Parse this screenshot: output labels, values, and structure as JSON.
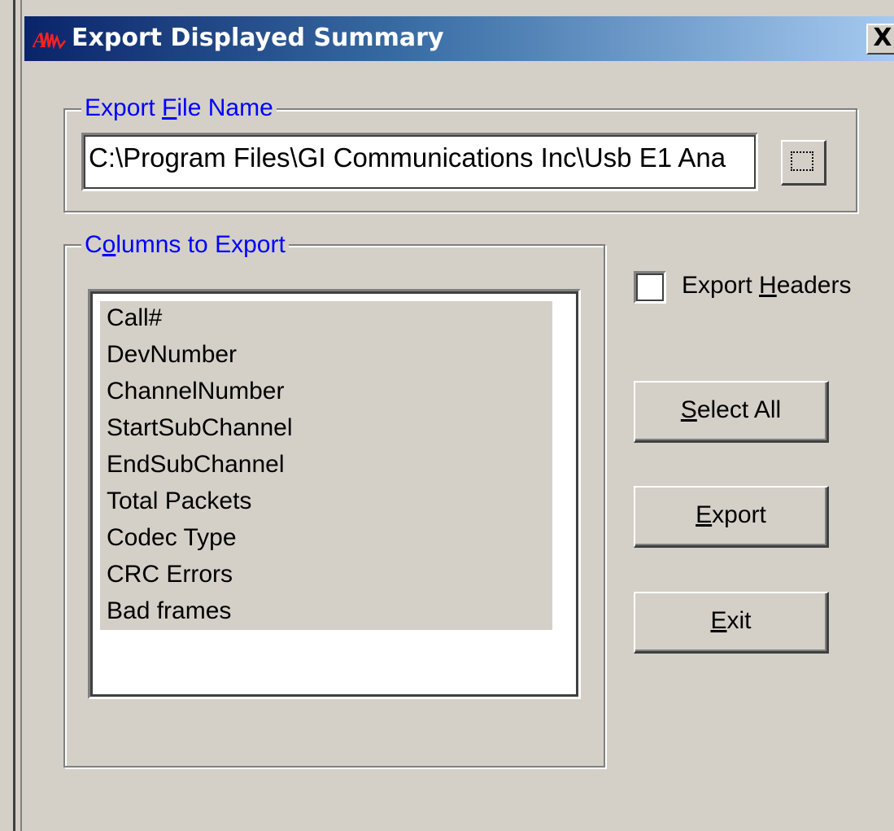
{
  "window": {
    "title": "Export Displayed Summary",
    "logo_icon": "app-logo-icon",
    "close_label": "X"
  },
  "export_file": {
    "legend_prefix": "Export ",
    "legend_accel": "F",
    "legend_suffix": "ile Name",
    "value": "C:\\Program Files\\GI Communications Inc\\Usb E1 Ana",
    "browse_icon": "browse-icon"
  },
  "columns": {
    "legend_prefix": "C",
    "legend_accel": "o",
    "legend_suffix": "lumns to Export",
    "items": [
      "Call#",
      "DevNumber",
      "ChannelNumber",
      "StartSubChannel",
      "EndSubChannel",
      "Total Packets",
      "Codec Type",
      "CRC Errors",
      "Bad frames"
    ]
  },
  "export_headers": {
    "prefix": "Export ",
    "accel": "H",
    "suffix": "eaders",
    "checked": false
  },
  "buttons": {
    "select_all": {
      "accel": "S",
      "rest": "elect All"
    },
    "export": {
      "accel": "E",
      "rest": "xport"
    },
    "exit": {
      "accel": "E",
      "rest": "xit"
    }
  },
  "colors": {
    "title_gradient_start": "#0a246a",
    "title_gradient_end": "#a6caf0",
    "legend_text": "#0000ff",
    "face": "#d4d0c8"
  }
}
